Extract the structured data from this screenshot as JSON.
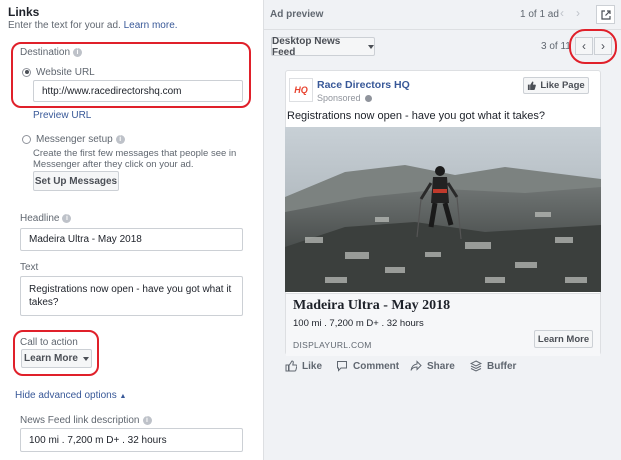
{
  "links": {
    "title": "Links",
    "subtitle": "Enter the text for your ad.",
    "learn_more": "Learn more.",
    "destination_label": "Destination",
    "website_url_label": "Website URL",
    "website_url_value": "http://www.racedirectorshq.com",
    "preview_url": "Preview URL",
    "messenger_label": "Messenger setup",
    "messenger_desc_1": "Create the first few messages that people see in",
    "messenger_desc_2": "Messenger after they click on your ad.",
    "setup_messages_btn": "Set Up Messages",
    "headline_label": "Headline",
    "headline_value": "Madeira Ultra - May 2018",
    "text_label": "Text",
    "text_value_1": "Registrations now open - have you got what it",
    "text_value_2": "takes?",
    "cta_label": "Call to action",
    "cta_value": "Learn More",
    "hide_advanced": "Hide advanced options",
    "news_feed_desc_label": "News Feed link description",
    "news_feed_desc_value": "100 mi . 7,200 m D+ . 32 hours"
  },
  "preview": {
    "title": "Ad preview",
    "pager_ads": "1 of 1 ad",
    "placement": "Desktop News Feed",
    "pager_placements": "3 of 11",
    "page_name": "Race Directors HQ",
    "sponsored": "Sponsored",
    "like_page": "Like Page",
    "post_text": "Registrations now open - have you got what it takes?",
    "headline": "Madeira Ultra - May 2018",
    "description": "100 mi . 7,200 m D+ . 32 hours",
    "display_url": "DISPLAYURL.COM",
    "learn_more": "Learn More",
    "actions": [
      "Like",
      "Comment",
      "Share",
      "Buffer"
    ],
    "logo_text": "HQ"
  },
  "colors": {
    "link": "#385898",
    "annotation": "#e0202a",
    "panel": "#f0f2f5"
  }
}
